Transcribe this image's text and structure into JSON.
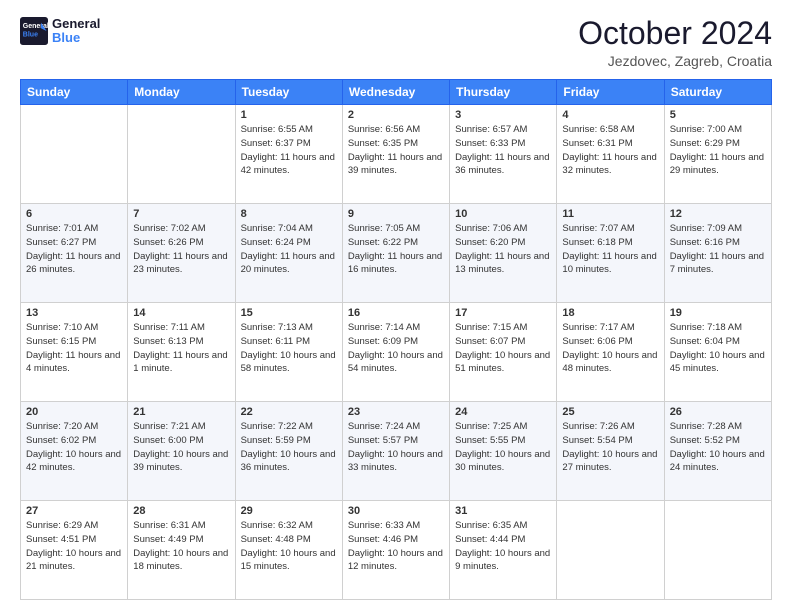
{
  "header": {
    "logo_line1": "General",
    "logo_line2": "Blue",
    "month": "October 2024",
    "location": "Jezdovec, Zagreb, Croatia"
  },
  "weekdays": [
    "Sunday",
    "Monday",
    "Tuesday",
    "Wednesday",
    "Thursday",
    "Friday",
    "Saturday"
  ],
  "weeks": [
    [
      {
        "day": "",
        "info": ""
      },
      {
        "day": "",
        "info": ""
      },
      {
        "day": "1",
        "info": "Sunrise: 6:55 AM\nSunset: 6:37 PM\nDaylight: 11 hours and 42 minutes."
      },
      {
        "day": "2",
        "info": "Sunrise: 6:56 AM\nSunset: 6:35 PM\nDaylight: 11 hours and 39 minutes."
      },
      {
        "day": "3",
        "info": "Sunrise: 6:57 AM\nSunset: 6:33 PM\nDaylight: 11 hours and 36 minutes."
      },
      {
        "day": "4",
        "info": "Sunrise: 6:58 AM\nSunset: 6:31 PM\nDaylight: 11 hours and 32 minutes."
      },
      {
        "day": "5",
        "info": "Sunrise: 7:00 AM\nSunset: 6:29 PM\nDaylight: 11 hours and 29 minutes."
      }
    ],
    [
      {
        "day": "6",
        "info": "Sunrise: 7:01 AM\nSunset: 6:27 PM\nDaylight: 11 hours and 26 minutes."
      },
      {
        "day": "7",
        "info": "Sunrise: 7:02 AM\nSunset: 6:26 PM\nDaylight: 11 hours and 23 minutes."
      },
      {
        "day": "8",
        "info": "Sunrise: 7:04 AM\nSunset: 6:24 PM\nDaylight: 11 hours and 20 minutes."
      },
      {
        "day": "9",
        "info": "Sunrise: 7:05 AM\nSunset: 6:22 PM\nDaylight: 11 hours and 16 minutes."
      },
      {
        "day": "10",
        "info": "Sunrise: 7:06 AM\nSunset: 6:20 PM\nDaylight: 11 hours and 13 minutes."
      },
      {
        "day": "11",
        "info": "Sunrise: 7:07 AM\nSunset: 6:18 PM\nDaylight: 11 hours and 10 minutes."
      },
      {
        "day": "12",
        "info": "Sunrise: 7:09 AM\nSunset: 6:16 PM\nDaylight: 11 hours and 7 minutes."
      }
    ],
    [
      {
        "day": "13",
        "info": "Sunrise: 7:10 AM\nSunset: 6:15 PM\nDaylight: 11 hours and 4 minutes."
      },
      {
        "day": "14",
        "info": "Sunrise: 7:11 AM\nSunset: 6:13 PM\nDaylight: 11 hours and 1 minute."
      },
      {
        "day": "15",
        "info": "Sunrise: 7:13 AM\nSunset: 6:11 PM\nDaylight: 10 hours and 58 minutes."
      },
      {
        "day": "16",
        "info": "Sunrise: 7:14 AM\nSunset: 6:09 PM\nDaylight: 10 hours and 54 minutes."
      },
      {
        "day": "17",
        "info": "Sunrise: 7:15 AM\nSunset: 6:07 PM\nDaylight: 10 hours and 51 minutes."
      },
      {
        "day": "18",
        "info": "Sunrise: 7:17 AM\nSunset: 6:06 PM\nDaylight: 10 hours and 48 minutes."
      },
      {
        "day": "19",
        "info": "Sunrise: 7:18 AM\nSunset: 6:04 PM\nDaylight: 10 hours and 45 minutes."
      }
    ],
    [
      {
        "day": "20",
        "info": "Sunrise: 7:20 AM\nSunset: 6:02 PM\nDaylight: 10 hours and 42 minutes."
      },
      {
        "day": "21",
        "info": "Sunrise: 7:21 AM\nSunset: 6:00 PM\nDaylight: 10 hours and 39 minutes."
      },
      {
        "day": "22",
        "info": "Sunrise: 7:22 AM\nSunset: 5:59 PM\nDaylight: 10 hours and 36 minutes."
      },
      {
        "day": "23",
        "info": "Sunrise: 7:24 AM\nSunset: 5:57 PM\nDaylight: 10 hours and 33 minutes."
      },
      {
        "day": "24",
        "info": "Sunrise: 7:25 AM\nSunset: 5:55 PM\nDaylight: 10 hours and 30 minutes."
      },
      {
        "day": "25",
        "info": "Sunrise: 7:26 AM\nSunset: 5:54 PM\nDaylight: 10 hours and 27 minutes."
      },
      {
        "day": "26",
        "info": "Sunrise: 7:28 AM\nSunset: 5:52 PM\nDaylight: 10 hours and 24 minutes."
      }
    ],
    [
      {
        "day": "27",
        "info": "Sunrise: 6:29 AM\nSunset: 4:51 PM\nDaylight: 10 hours and 21 minutes."
      },
      {
        "day": "28",
        "info": "Sunrise: 6:31 AM\nSunset: 4:49 PM\nDaylight: 10 hours and 18 minutes."
      },
      {
        "day": "29",
        "info": "Sunrise: 6:32 AM\nSunset: 4:48 PM\nDaylight: 10 hours and 15 minutes."
      },
      {
        "day": "30",
        "info": "Sunrise: 6:33 AM\nSunset: 4:46 PM\nDaylight: 10 hours and 12 minutes."
      },
      {
        "day": "31",
        "info": "Sunrise: 6:35 AM\nSunset: 4:44 PM\nDaylight: 10 hours and 9 minutes."
      },
      {
        "day": "",
        "info": ""
      },
      {
        "day": "",
        "info": ""
      }
    ]
  ]
}
